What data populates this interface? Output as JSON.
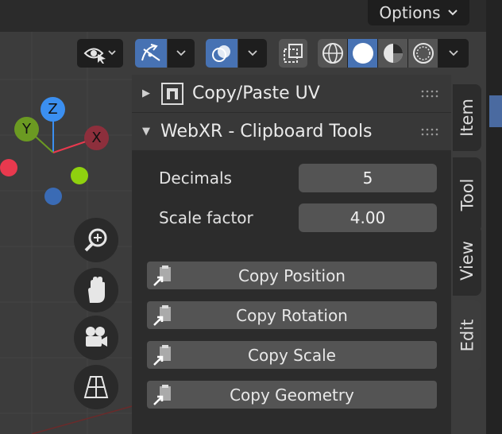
{
  "header": {
    "options_label": "Options"
  },
  "gizmo": {
    "z_label": "Z",
    "y_label": "Y",
    "x_label": "X",
    "colors": {
      "x": "#e8394e",
      "y": "#6b9a22",
      "z": "#3b8ff0"
    }
  },
  "panels": {
    "copy_paste_uv": {
      "title": "Copy/Paste UV",
      "collapsed": true
    },
    "clipboard_tools": {
      "title": "WebXR - Clipboard Tools",
      "collapsed": false,
      "properties": [
        {
          "label": "Decimals",
          "value": "5"
        },
        {
          "label": "Scale factor",
          "value": "4.00"
        }
      ],
      "buttons": [
        {
          "label": "Copy Position"
        },
        {
          "label": "Copy Rotation"
        },
        {
          "label": "Copy Scale"
        },
        {
          "label": "Copy Geometry"
        }
      ]
    }
  },
  "sidebar_tabs": [
    {
      "label": "Item"
    },
    {
      "label": "Tool"
    },
    {
      "label": "View"
    },
    {
      "label": "Edit",
      "active": true
    }
  ],
  "colors": {
    "accent_blue": "#4772b3",
    "button_gray": "#545454",
    "panel_bg": "#2c2c2c"
  }
}
